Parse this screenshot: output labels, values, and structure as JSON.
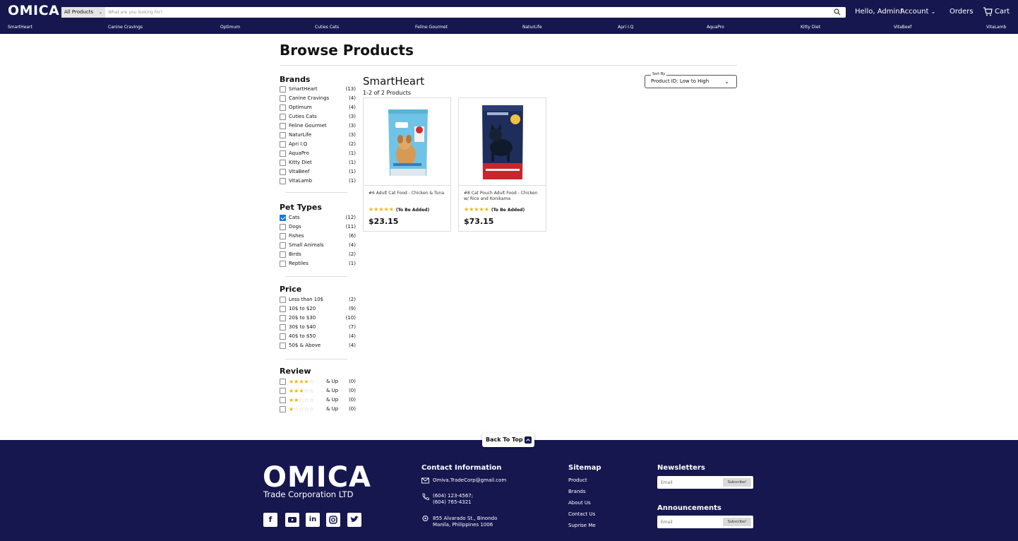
{
  "header": {
    "logo": "OMICA",
    "category_select": "All Products",
    "search_placeholder": "What are you looking for?",
    "greeting": "Hello, Admin!",
    "account": "Account",
    "orders": "Orders",
    "cart": "Cart"
  },
  "brand_nav": [
    "SmartHeart",
    "Canine Cravings",
    "Optimum",
    "Cuties Cats",
    "Feline Gourmet",
    "NaturLife",
    "Apri I.Q",
    "AquaPro",
    "Kitty Diet",
    "VitaBeef",
    "VitaLamb"
  ],
  "page": {
    "title": "Browse Products",
    "brand_heading": "SmartHeart",
    "result_count": "1-2 of 2 Products"
  },
  "sort": {
    "label": "Sort By",
    "value": "Product ID: Low to High"
  },
  "filters": {
    "brands": {
      "title": "Brands",
      "items": [
        {
          "label": "SmartHeart",
          "count": "(13)"
        },
        {
          "label": "Canine Cravings",
          "count": "(4)"
        },
        {
          "label": "Optimum",
          "count": "(4)"
        },
        {
          "label": "Cuties Cats",
          "count": "(3)"
        },
        {
          "label": "Feline Gourmet",
          "count": "(3)"
        },
        {
          "label": "NaturLife",
          "count": "(3)"
        },
        {
          "label": "Apri I.Q",
          "count": "(2)"
        },
        {
          "label": "AquaPro",
          "count": "(1)"
        },
        {
          "label": "Kitty Diet",
          "count": "(1)"
        },
        {
          "label": "VitaBeef",
          "count": "(1)"
        },
        {
          "label": "VitaLamb",
          "count": "(1)"
        }
      ]
    },
    "pet_types": {
      "title": "Pet Types",
      "items": [
        {
          "label": "Cats",
          "count": "(12)",
          "checked": true
        },
        {
          "label": "Dogs",
          "count": "(11)"
        },
        {
          "label": "Fishes",
          "count": "(6)"
        },
        {
          "label": "Small Animals",
          "count": "(4)"
        },
        {
          "label": "Birds",
          "count": "(2)"
        },
        {
          "label": "Reptiles",
          "count": "(1)"
        }
      ]
    },
    "price": {
      "title": "Price",
      "items": [
        {
          "label": "Less than 10$",
          "count": "(2)"
        },
        {
          "label": "10$ to $20",
          "count": "(9)"
        },
        {
          "label": "20$ to $30",
          "count": "(10)"
        },
        {
          "label": "30$ to $40",
          "count": "(7)"
        },
        {
          "label": "40$ to $50",
          "count": "(4)"
        },
        {
          "label": "50$ & Above",
          "count": "(4)"
        }
      ]
    },
    "review": {
      "title": "Review",
      "and_up": "& Up",
      "items": [
        {
          "stars": 4,
          "count": "(0)"
        },
        {
          "stars": 3,
          "count": "(0)"
        },
        {
          "stars": 2,
          "count": "(0)"
        },
        {
          "stars": 1,
          "count": "(0)"
        }
      ]
    }
  },
  "products": [
    {
      "name": "#6 Adult Cat Food - Chicken & Tuna",
      "rating_text": "(To Be Added)",
      "stars": 5,
      "price": "$23.15"
    },
    {
      "name": "#8 Cat Pouch Adult Food - Chicken w/ Rice and Konikama",
      "rating_text": "(To Be Added)",
      "stars": 5,
      "price": "$73.15"
    }
  ],
  "footer": {
    "back_to_top": "Back To Top",
    "logo": "OMICA",
    "tagline": "Trade Corporation LTD",
    "social": [
      "facebook-icon",
      "youtube-icon",
      "linkedin-icon",
      "instagram-icon",
      "twitter-icon"
    ],
    "contact": {
      "title": "Contact Information",
      "email": "Omiva.TradeCorp@gmail.com",
      "phone1": "(604) 123-4567;",
      "phone2": "(604) 765-4321",
      "address1": "855 Alvarado St., Binondo",
      "address2": "Manila, Philippines 1006"
    },
    "sitemap": {
      "title": "Sitemap",
      "links": [
        "Product",
        "Brands",
        "About Us",
        "Contact Us",
        "Suprise Me"
      ]
    },
    "newsletters": {
      "title": "Newsletters",
      "placeholder": "Email",
      "button": "Subscribe!"
    },
    "announcements": {
      "title": "Announcements",
      "placeholder": "Email",
      "button": "Subscribe!"
    }
  },
  "colors": {
    "navy": "#16174f",
    "star": "#f5b301",
    "check": "#1a73e8"
  }
}
